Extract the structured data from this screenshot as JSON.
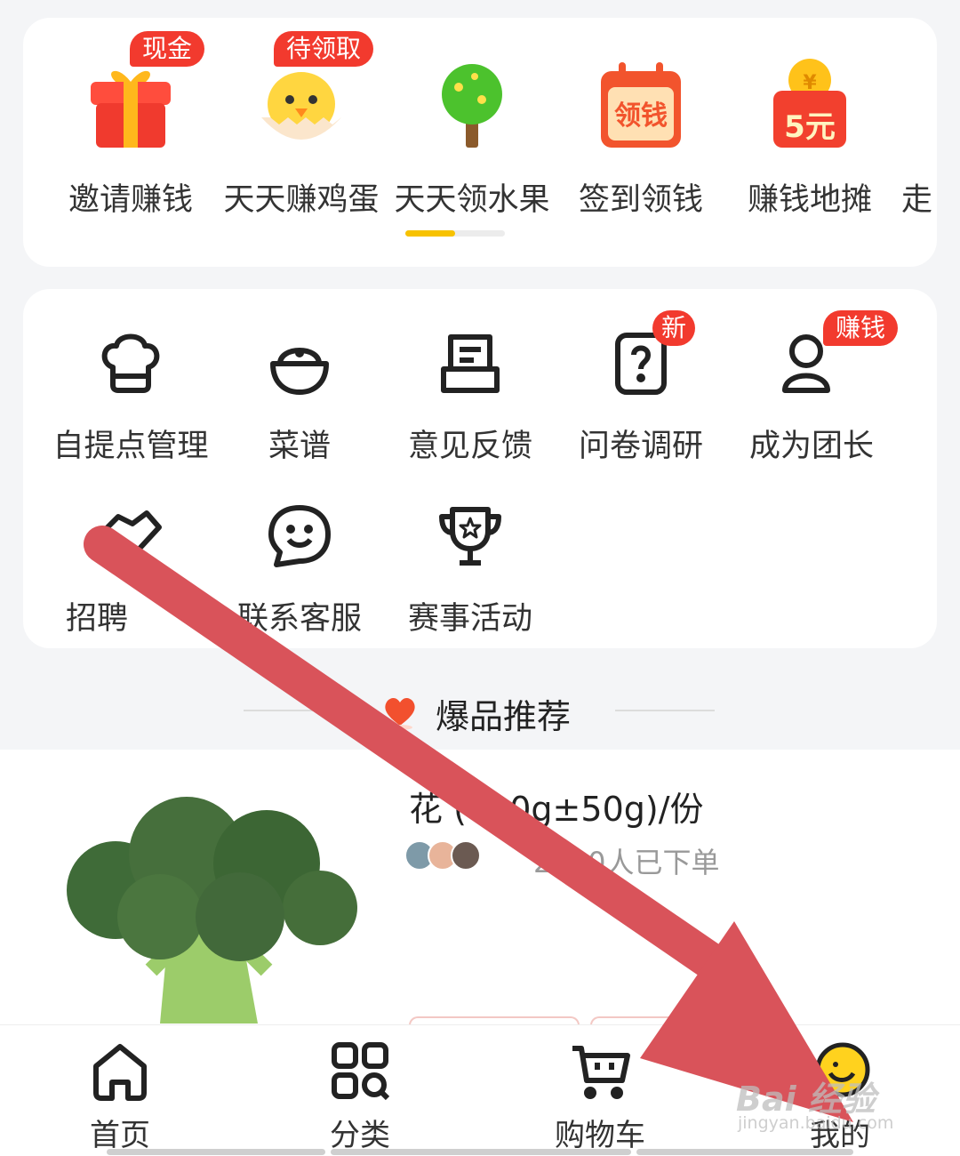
{
  "earn": {
    "items": [
      {
        "label": "邀请赚钱",
        "badge": "现金",
        "icon": "gift-box-icon"
      },
      {
        "label": "天天赚鸡蛋",
        "badge": "待领取",
        "icon": "chick-egg-icon"
      },
      {
        "label": "天天领水果",
        "icon": "fruit-tree-icon"
      },
      {
        "label": "签到领钱",
        "icon": "calendar-coin-icon",
        "icon_text": "领钱"
      },
      {
        "label": "赚钱地摊",
        "icon": "red-envelope-icon",
        "icon_text": "5元",
        "coin_symbol": "¥"
      },
      {
        "label": "走"
      }
    ],
    "scroll_progress": 0.5
  },
  "services": {
    "items": [
      {
        "label": "自提点管理",
        "icon": "chef-hat-icon"
      },
      {
        "label": "菜谱",
        "icon": "rice-bowl-icon"
      },
      {
        "label": "意见反馈",
        "icon": "feedback-box-icon"
      },
      {
        "label": "问卷调研",
        "icon": "question-doc-icon",
        "badge": "新"
      },
      {
        "label": "成为团长",
        "icon": "person-icon",
        "badge": "赚钱"
      },
      {
        "label": "招聘",
        "icon": "handshake-icon"
      },
      {
        "label": "联系客服",
        "icon": "smile-chat-icon"
      },
      {
        "label": "赛事活动",
        "icon": "trophy-icon"
      }
    ]
  },
  "recommend": {
    "title": "爆品推荐",
    "icon": "heart-icon"
  },
  "product": {
    "title": "花 (400g±50g)/份",
    "sold": "2030人已下单",
    "image": "broccoli-image"
  },
  "tabbar": {
    "items": [
      {
        "label": "首页",
        "icon": "home-icon"
      },
      {
        "label": "分类",
        "icon": "category-icon"
      },
      {
        "label": "购物车",
        "icon": "cart-icon"
      },
      {
        "label": "我的",
        "icon": "mine-face-icon"
      }
    ]
  },
  "watermark": {
    "text": "Bai 经验",
    "sub": "jingyan.baidu.com"
  },
  "colors": {
    "accent_yellow": "#f7c200",
    "badge_red": "#f23a2e",
    "arrow_red": "#d9535a"
  }
}
